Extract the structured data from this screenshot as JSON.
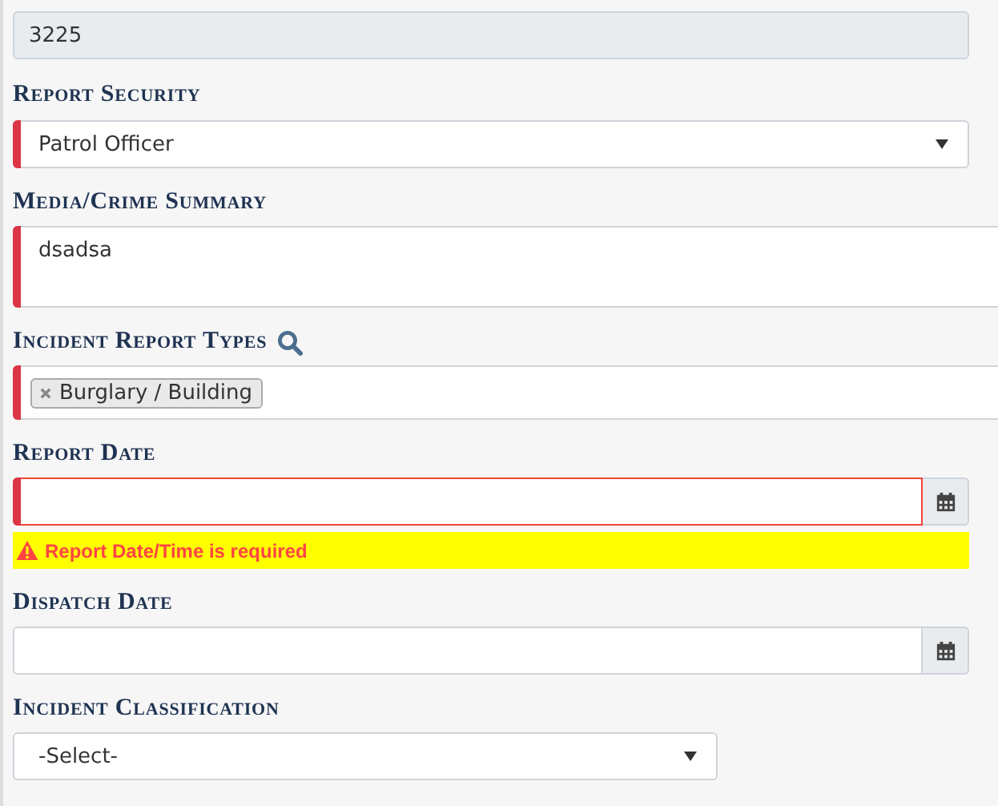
{
  "fields": [
    {
      "kind": "readonly",
      "value": "3225"
    },
    {
      "kind": "select",
      "label": "Report Security",
      "value": "Patrol Officer",
      "required": true
    },
    {
      "kind": "textarea",
      "label": "Media/Crime Summary",
      "value": "dsadsa",
      "required": true
    },
    {
      "kind": "tags",
      "label": "Incident Report Types",
      "search": true,
      "tags": [
        "Burglary / Building"
      ],
      "required": true
    },
    {
      "kind": "date",
      "label": "Report Date",
      "required": true,
      "invalid": true,
      "error": "Report Date/Time is required"
    },
    {
      "kind": "date",
      "label": "Dispatch Date",
      "required": false,
      "invalid": false
    },
    {
      "kind": "select",
      "label": "Incident Classification",
      "value": "-Select-",
      "required": false
    }
  ]
}
